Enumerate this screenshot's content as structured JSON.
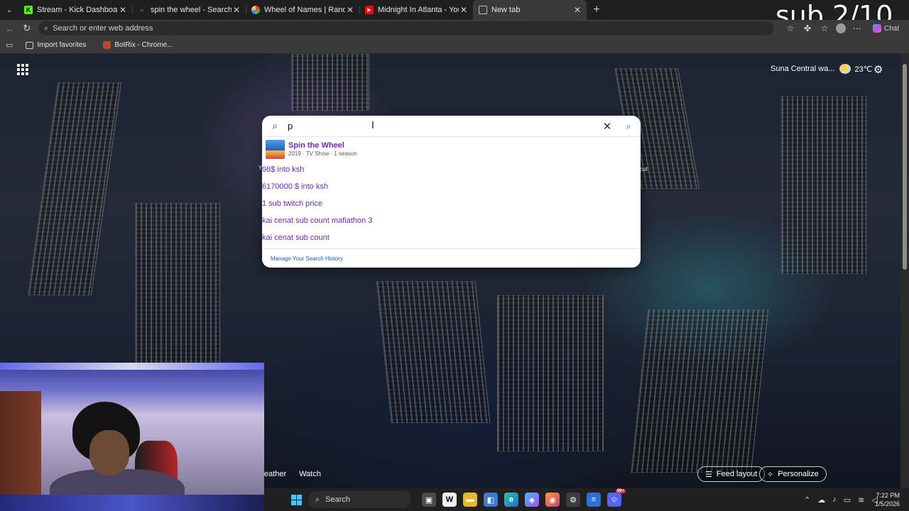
{
  "overlay": {
    "sub_counter": "sub 2/10"
  },
  "tabs": [
    {
      "title": "Stream - Kick Dashboard",
      "icon": "kick-icon",
      "color": "#53fc18"
    },
    {
      "title": "spin the wheel - Search",
      "icon": "bing-search-icon",
      "color": "#1a73c2"
    },
    {
      "title": "Wheel of Names | Random name pic",
      "icon": "wheel-icon",
      "color": "#e4b52b"
    },
    {
      "title": "Midnight In Atlanta - YouTube",
      "icon": "youtube-icon",
      "color": "#ff0000"
    },
    {
      "title": "New tab",
      "icon": "newtab-icon",
      "color": "#bdbdbd",
      "active": true
    }
  ],
  "address_bar": {
    "placeholder": "Search or enter web address"
  },
  "toolbar": {
    "chat_label": "Chat"
  },
  "favorites": [
    {
      "label": "Import favorites",
      "icon": "import-icon"
    },
    {
      "label": "BotRix - Chrome...",
      "icon": "botrix-icon"
    }
  ],
  "weather": {
    "location": "Suna Central wa...",
    "temp": "23℃"
  },
  "side_labels": {
    "left": "Y",
    "right": "cut"
  },
  "search": {
    "query": "p",
    "rich_result": {
      "title": "Spin the Wheel",
      "subtitle": "2019 · TV Show · 1 season"
    },
    "history": [
      "98$ into ksh",
      "6170000 $ into ksh",
      "1 sub twitch price",
      "kai cenat sub count mafiathon 3",
      "kai cenat sub count"
    ],
    "manage_link": "Manage Your Search History"
  },
  "feed": {
    "left_items": [
      "eather",
      "Watch"
    ],
    "feed_layout_label": "Feed layout",
    "personalize_label": "Personalize"
  },
  "taskbar": {
    "search_label": "Search",
    "time": "7:22 PM",
    "date": "1/5/2026",
    "discord_badge": "99+"
  }
}
